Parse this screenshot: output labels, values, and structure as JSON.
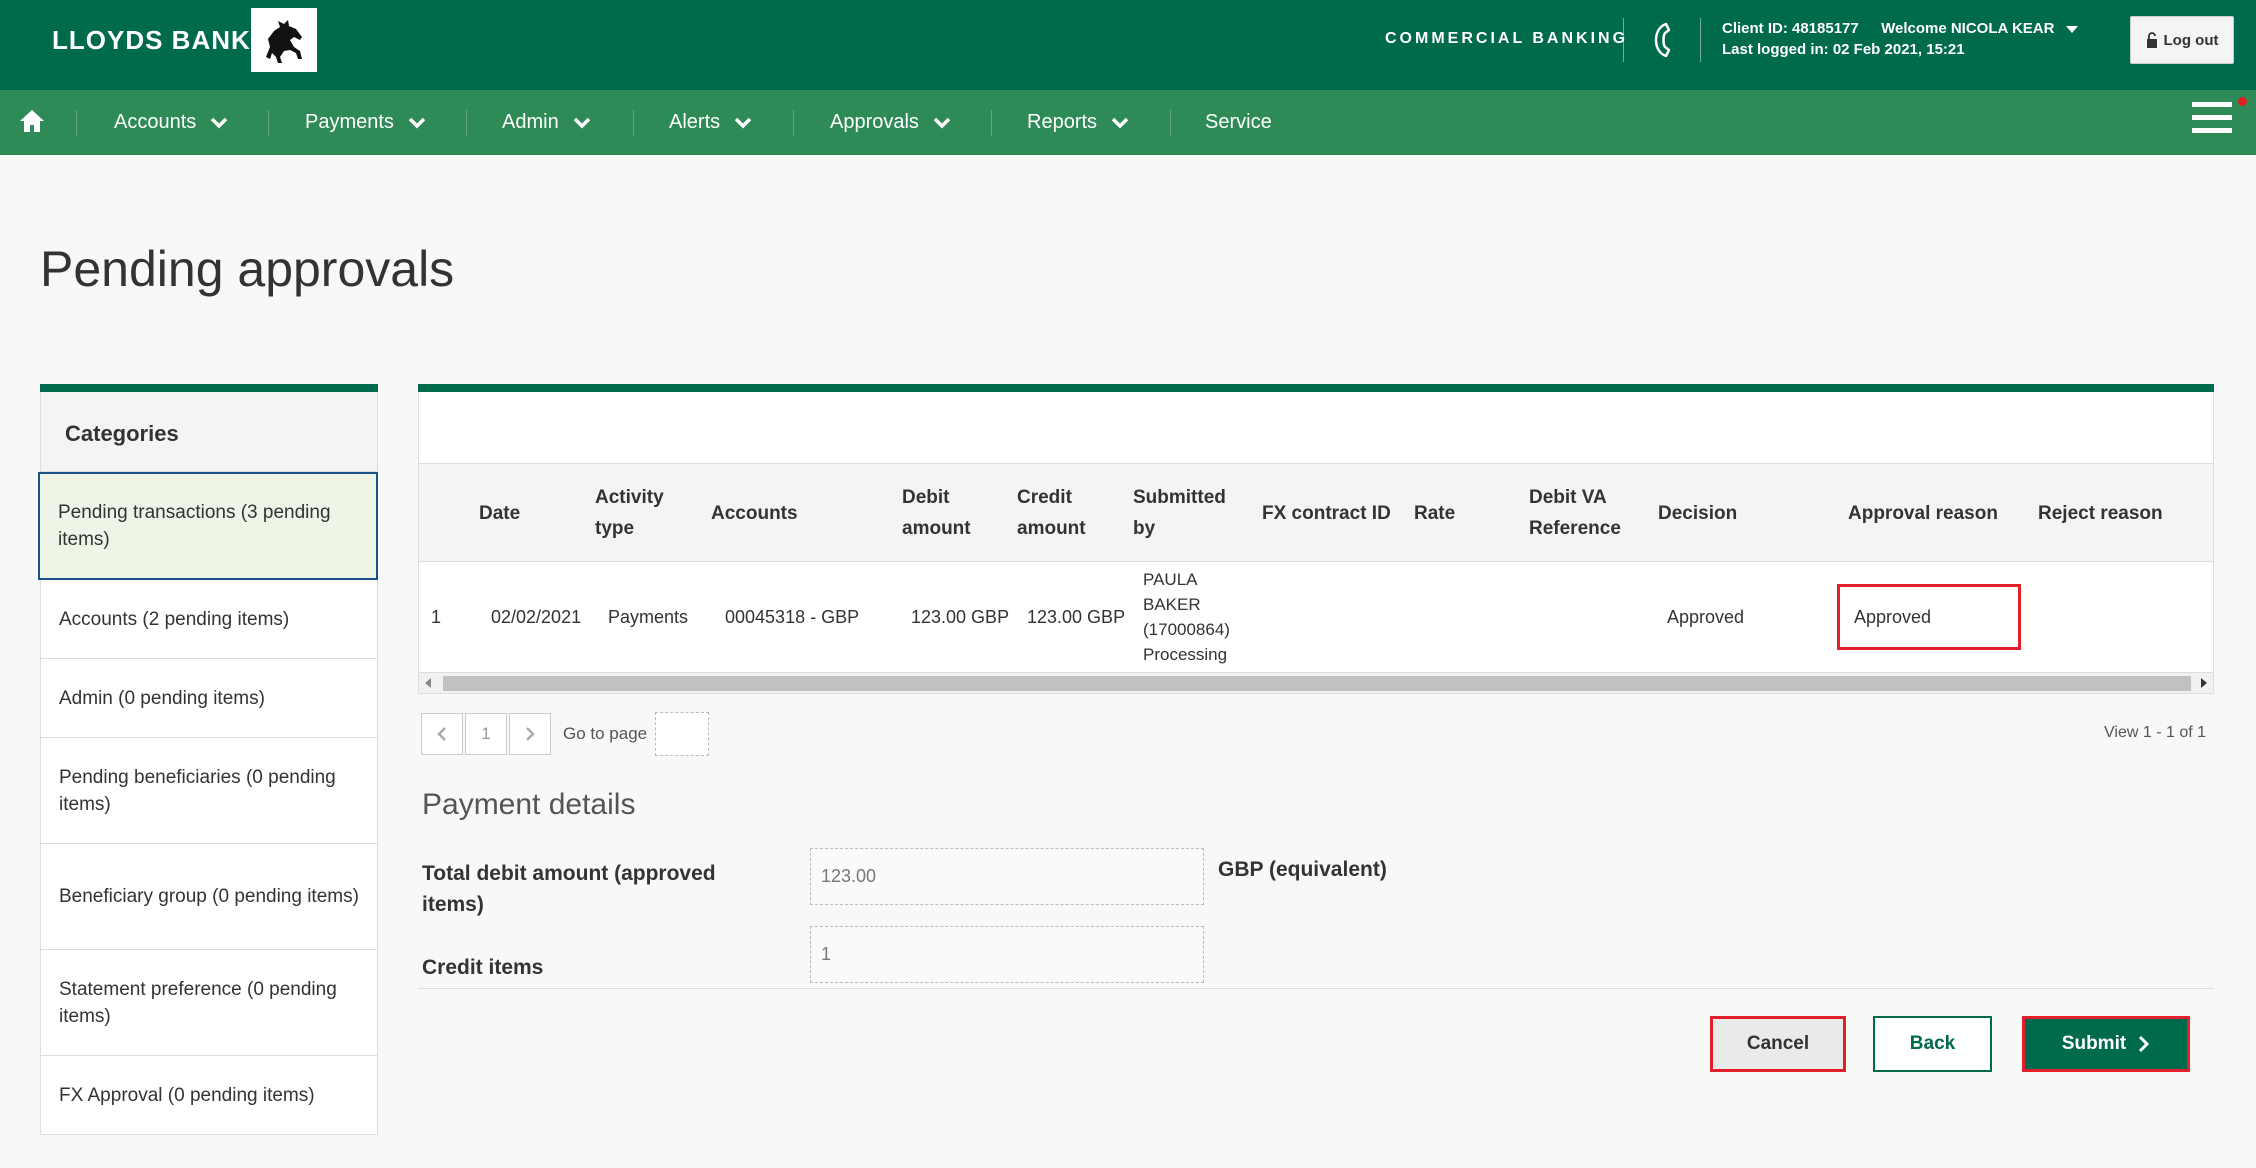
{
  "header": {
    "brand": "LLOYDS BANK",
    "segment": "COMMERCIAL BANKING",
    "client_line": "Client ID: 48185177",
    "welcome": "Welcome NICOLA KEAR",
    "last_login": "Last logged in: 02 Feb 2021, 15:21",
    "logout_label": "Log out",
    "logo_icon": "black-horse-icon",
    "phone_icon": "phone-icon"
  },
  "nav": {
    "home_icon": "home-icon",
    "items": [
      {
        "label": "Accounts"
      },
      {
        "label": "Payments"
      },
      {
        "label": "Admin"
      },
      {
        "label": "Alerts"
      },
      {
        "label": "Approvals"
      },
      {
        "label": "Reports"
      },
      {
        "label": "Service"
      }
    ],
    "menu_icon": "hamburger-menu-icon"
  },
  "page": {
    "title": "Pending approvals"
  },
  "sidebar": {
    "heading": "Categories",
    "items": [
      {
        "label": "Pending transactions (3 pending items)",
        "active": true
      },
      {
        "label": "Accounts (2 pending items)"
      },
      {
        "label": "Admin (0 pending items)"
      },
      {
        "label": "Pending beneficiaries (0 pending items)"
      },
      {
        "label": "Beneficiary group (0 pending items)"
      },
      {
        "label": "Statement preference (0 pending items)"
      },
      {
        "label": "FX Approval (0 pending items)"
      }
    ]
  },
  "table": {
    "columns": {
      "date": "Date",
      "activity": "Activity type",
      "accounts": "Accounts",
      "debit": "Debit amount",
      "credit": "Credit amount",
      "submitted": "Submitted by",
      "fx": "FX contract ID",
      "rate": "Rate",
      "debit_va": "Debit VA Reference",
      "decision": "Decision",
      "approval_reason": "Approval reason",
      "reject_reason": "Reject reason"
    },
    "rows": [
      {
        "index": "1",
        "date": "02/02/2021",
        "activity": "Payments",
        "accounts": "00045318 - GBP",
        "debit": "123.00 GBP",
        "credit": "123.00 GBP",
        "submitted_name": "PAULA BAKER",
        "submitted_id": "(17000864)",
        "submitted_status": "Processing",
        "fx": "",
        "rate": "",
        "debit_va": "",
        "decision": "Approved",
        "approval_reason": "Approved",
        "reject_reason": ""
      }
    ]
  },
  "pager": {
    "current_page": "1",
    "goto_label": "Go to page",
    "goto_value": "",
    "view_count": "View 1 - 1 of 1"
  },
  "payment_details": {
    "title": "Payment details",
    "total_debit_label": "Total debit amount (approved items)",
    "total_debit_value": "123.00",
    "total_debit_unit": "GBP (equivalent)",
    "credit_items_label": "Credit items",
    "credit_items_value": "1"
  },
  "actions": {
    "cancel_label": "Cancel",
    "back_label": "Back",
    "submit_label": "Submit"
  }
}
